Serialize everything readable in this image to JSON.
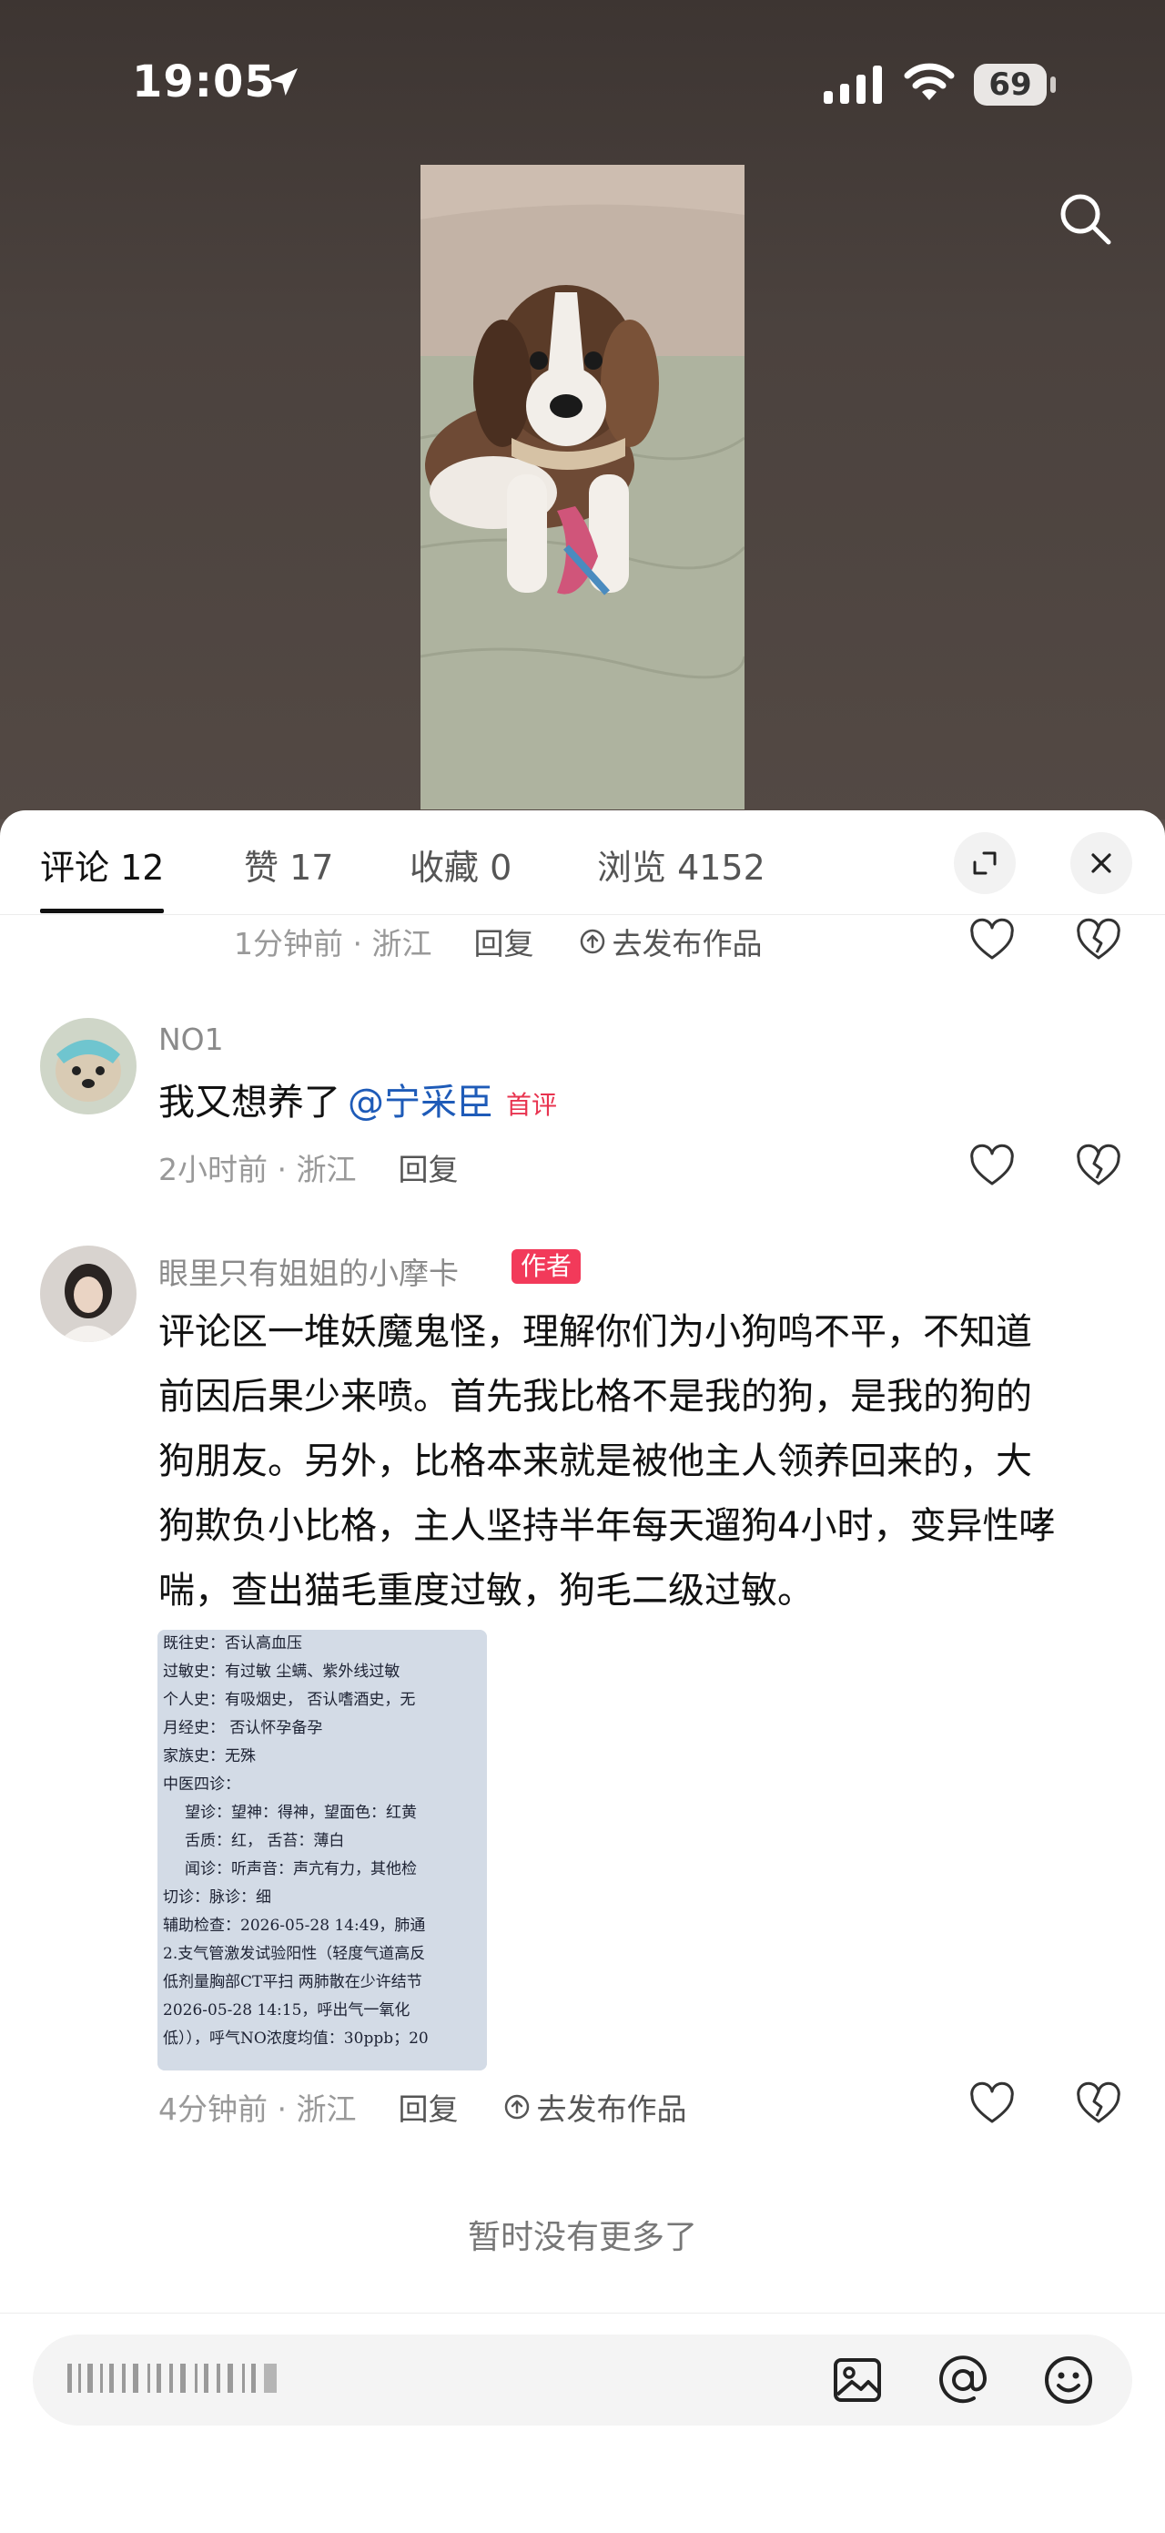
{
  "status_bar": {
    "time": "19:05",
    "battery": "69"
  },
  "tabs": [
    {
      "label": "评论 12"
    },
    {
      "label": "赞 17"
    },
    {
      "label": "收藏 0"
    },
    {
      "label": "浏览 4152"
    }
  ],
  "comments": [
    {
      "meta": "1分钟前 · 浙江",
      "reply": "回复",
      "publish": "去发布作品"
    },
    {
      "user": "NO1",
      "text_prefix": "我又想养了",
      "mention": "@宁采臣",
      "first_badge": "首评",
      "meta": "2小时前 · 浙江",
      "reply": "回复"
    },
    {
      "user": "眼里只有姐姐的小摩卡",
      "author_badge": "作者",
      "lines": [
        "评论区一堆妖魔鬼怪，理解你们为小狗鸣不平，不知道",
        "前因后果少来喷。首先我比格不是我的狗，是我的狗的",
        "狗朋友。另外，比格本来就是被他主人领养回来的，大",
        "狗欺负小比格，主人坚持半年每天遛狗4小时，变异性哮",
        "喘，查出猫毛重度过敏，狗毛二级过敏。"
      ],
      "meta": "4分钟前 · 浙江",
      "reply": "回复",
      "publish": "去发布作品"
    }
  ],
  "doc_image_lines": [
    "既往史：否认高血压",
    "过敏史：有过敏  尘螨、紫外线过敏",
    "个人史：有吸烟史，  否认嗜酒史，无",
    "月经史：  否认怀孕备孕",
    "家族史：无殊",
    "中医四诊：",
    "望诊：望神：得神，望面色：红黄",
    "舌质：红，    舌苔：薄白",
    "闻诊：听声音：声亢有力，其他检",
    "切诊：脉诊：细",
    "辅助检查：2026-05-28 14:49，肺通",
    "2.支气管激发试验阳性（轻度气道高反",
    "低剂量胸部CT平扫  两肺散在少许结节",
    "2026-05-28 14:15，呼出气一氧化",
    "低）），呼气NO浓度均值：30ppb；20"
  ],
  "no_more_text": "暂时没有更多了"
}
